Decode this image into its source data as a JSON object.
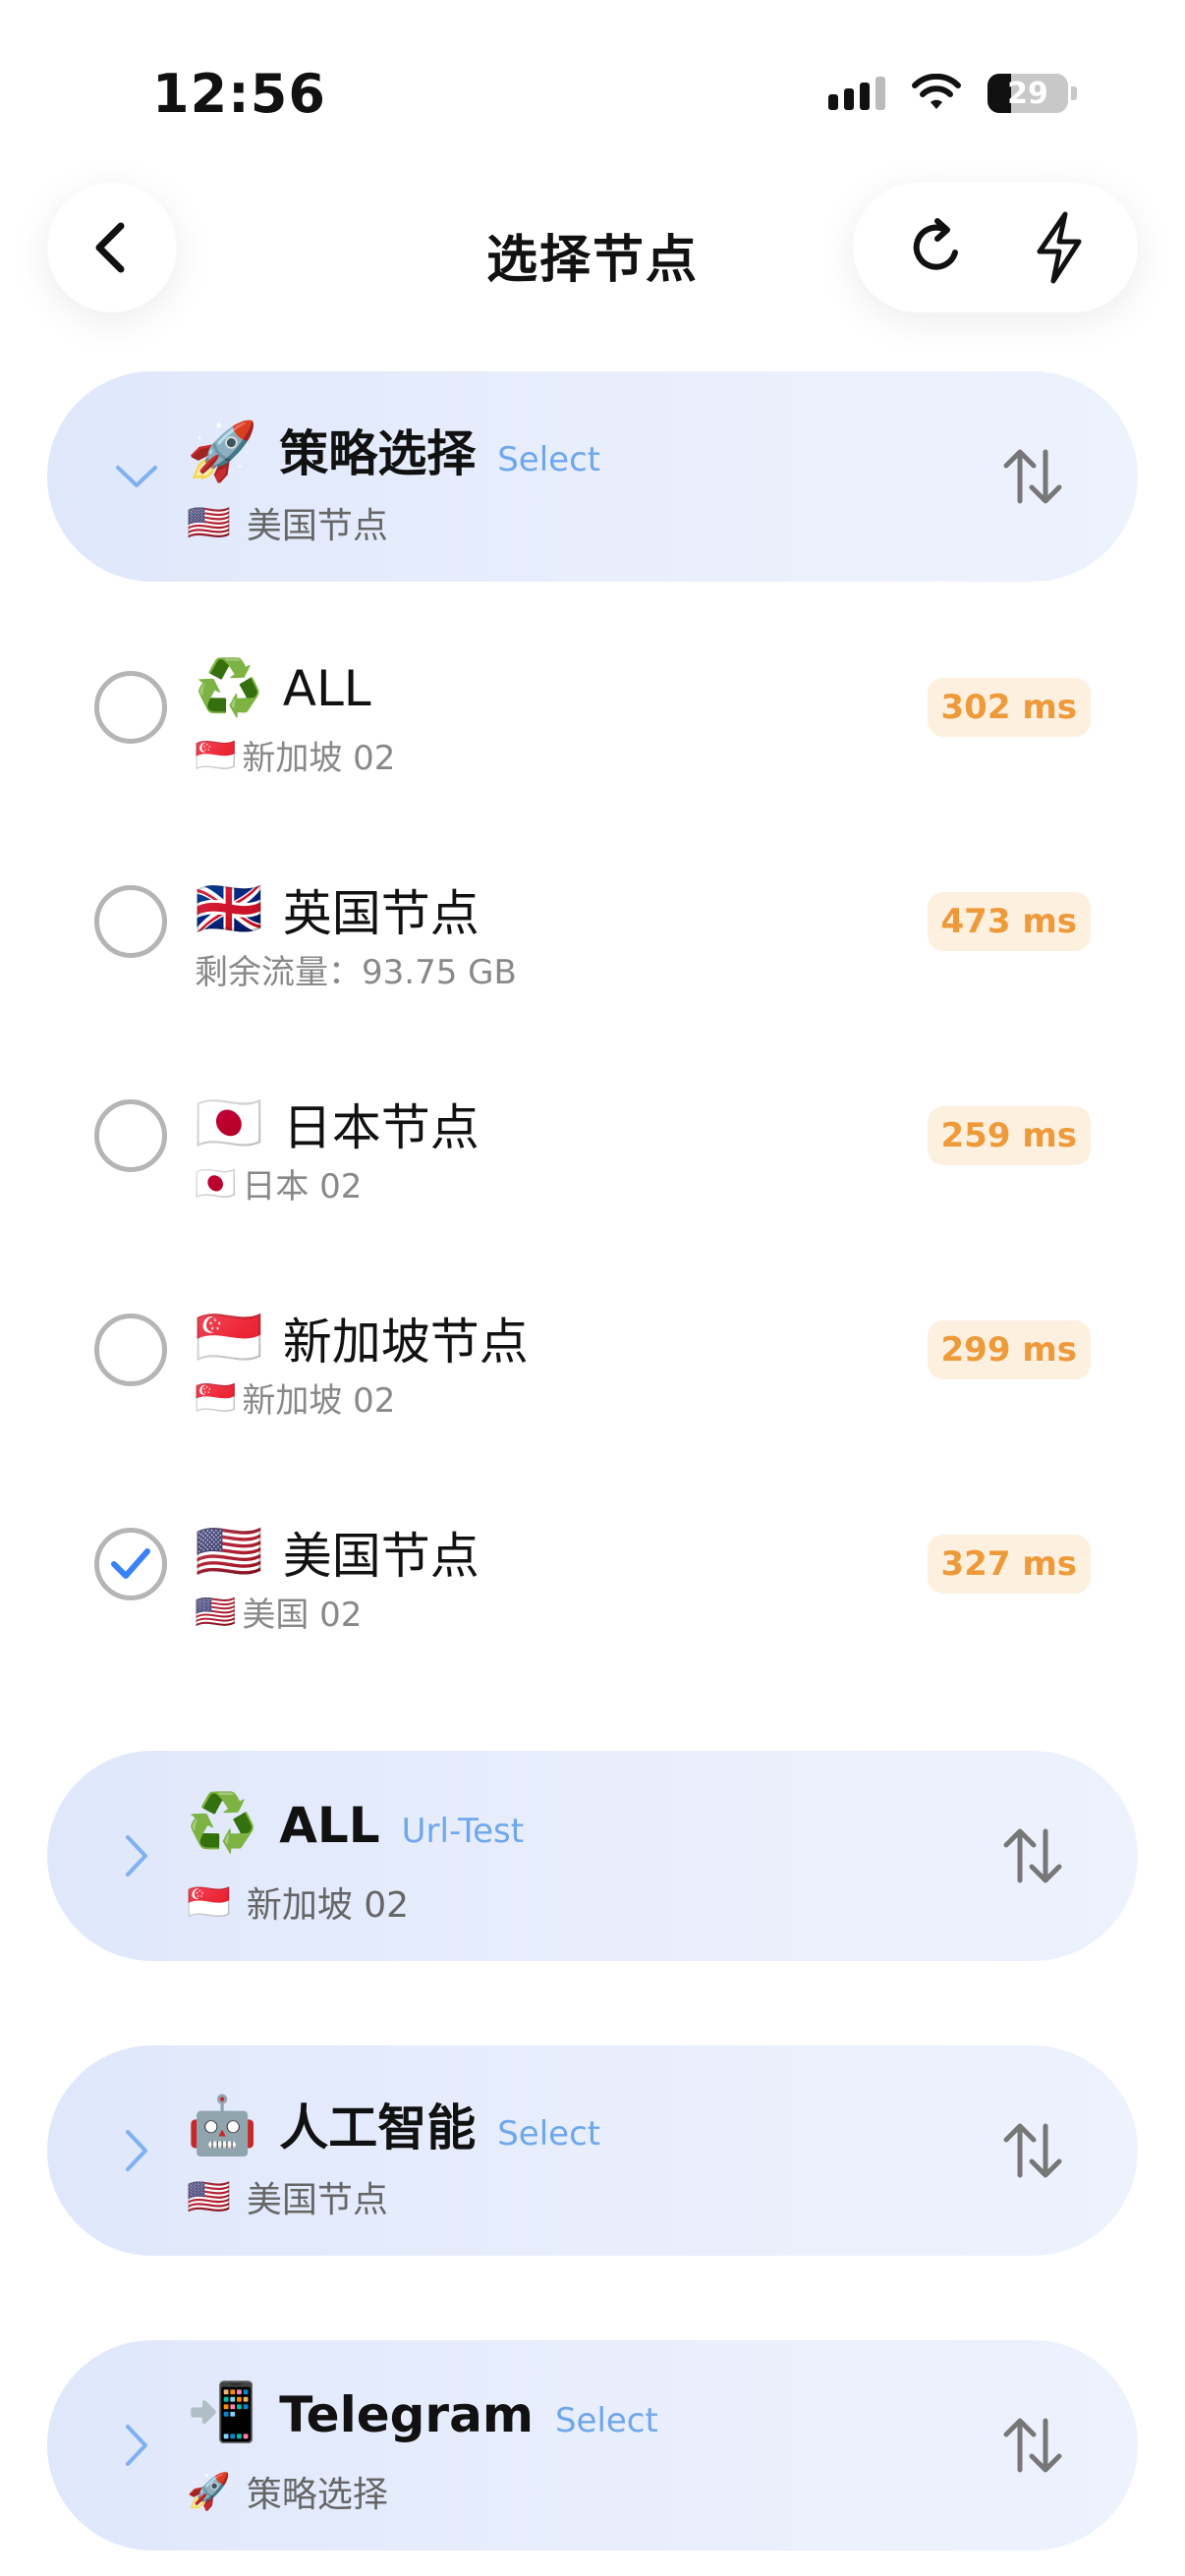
{
  "status_bar": {
    "time": "12:56",
    "battery": "29"
  },
  "nav": {
    "title": "选择节点",
    "back_icon": "chevron-left-icon",
    "refresh_icon": "refresh-icon",
    "speedtest_icon": "lightning-icon"
  },
  "expanded_group": {
    "emoji": "🚀",
    "name": "策略选择",
    "type": "Select",
    "selected_flag": "🇺🇸",
    "selected": "美国节点",
    "options": [
      {
        "emoji": "♻️",
        "name": "ALL",
        "sub_flag": "🇸🇬",
        "sub": "新加坡 02",
        "latency": "302 ms",
        "checked": false
      },
      {
        "emoji": "🇬🇧",
        "name": "英国节点",
        "sub_flag": "",
        "sub": "剩余流量：93.75 GB",
        "latency": "473 ms",
        "checked": false
      },
      {
        "emoji": "🇯🇵",
        "name": "日本节点",
        "sub_flag": "🇯🇵",
        "sub": "日本 02",
        "latency": "259 ms",
        "checked": false
      },
      {
        "emoji": "🇸🇬",
        "name": "新加坡节点",
        "sub_flag": "🇸🇬",
        "sub": "新加坡 02",
        "latency": "299 ms",
        "checked": false
      },
      {
        "emoji": "🇺🇸",
        "name": "美国节点",
        "sub_flag": "🇺🇸",
        "sub": "美国 02",
        "latency": "327 ms",
        "checked": true
      }
    ]
  },
  "groups": [
    {
      "emoji": "♻️",
      "name": "ALL",
      "type": "Url-Test",
      "selected_flag": "🇸🇬",
      "selected": "新加坡 02"
    },
    {
      "emoji": "🤖",
      "name": "人工智能",
      "type": "Select",
      "selected_flag": "🇺🇸",
      "selected": "美国节点"
    },
    {
      "emoji": "📲",
      "name": "Telegram",
      "type": "Select",
      "selected_flag": "🚀",
      "selected": "策略选择"
    }
  ],
  "colors": {
    "accent_blue": "#3b82f6",
    "type_label": "#6fa7ec",
    "latency_text": "#ee9a3a",
    "latency_bg": "#fdf0df",
    "card_bg": "#e4ebfc"
  }
}
